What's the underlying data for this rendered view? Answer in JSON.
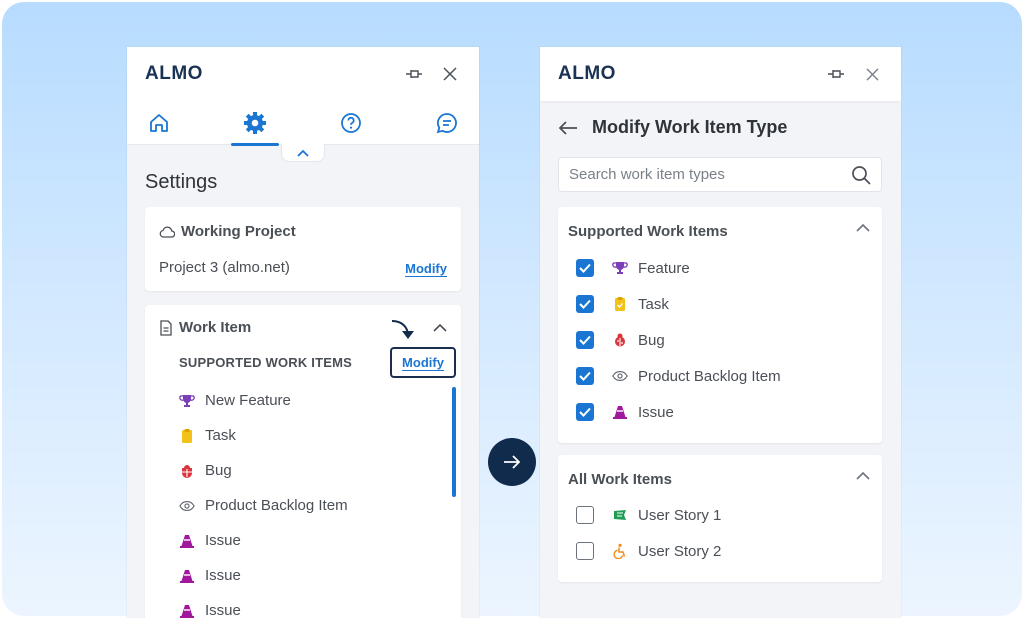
{
  "app": {
    "logo_text": "ALMO"
  },
  "left_panel": {
    "settings_title": "Settings",
    "nav_tabs": [
      "home",
      "settings",
      "help",
      "chat"
    ],
    "working_project": {
      "title": "Working Project",
      "project_name": "Project 3 (almo.net)",
      "modify_label": "Modify"
    },
    "work_item": {
      "title": "Work Item",
      "section_label": "SUPPORTED WORK ITEMS",
      "modify_label": "Modify",
      "items": [
        {
          "label": "New Feature",
          "icon": "trophy-icon",
          "color": "#7b3fb8"
        },
        {
          "label": "Task",
          "icon": "clipboard-icon",
          "color": "#f2c21b"
        },
        {
          "label": "Bug",
          "icon": "bug-icon",
          "color": "#d9363e"
        },
        {
          "label": "Product Backlog Item",
          "icon": "eye-icon",
          "color": "#5f656d"
        },
        {
          "label": "Issue",
          "icon": "cone-icon",
          "color": "#a0199c"
        },
        {
          "label": "Issue",
          "icon": "cone-icon",
          "color": "#a0199c"
        },
        {
          "label": "Issue",
          "icon": "cone-icon",
          "color": "#a0199c"
        }
      ]
    }
  },
  "right_panel": {
    "title": "Modify Work Item Type",
    "search_placeholder": "Search work item types",
    "supported": {
      "title": "Supported Work Items",
      "items": [
        {
          "label": "Feature",
          "checked": true,
          "icon": "trophy-icon",
          "color": "#7b3fb8"
        },
        {
          "label": "Task",
          "checked": true,
          "icon": "clipboard-icon",
          "color": "#f2c21b"
        },
        {
          "label": "Bug",
          "checked": true,
          "icon": "bug-icon",
          "color": "#d9363e"
        },
        {
          "label": "Product Backlog Item",
          "checked": true,
          "icon": "eye-icon",
          "color": "#5f656d"
        },
        {
          "label": "Issue",
          "checked": true,
          "icon": "cone-icon",
          "color": "#a0199c"
        }
      ]
    },
    "all": {
      "title": "All Work Items",
      "items": [
        {
          "label": "User Story 1",
          "checked": false,
          "icon": "flag-icon",
          "color": "#1f9d55"
        },
        {
          "label": "User Story 2",
          "checked": false,
          "icon": "accessibility-icon",
          "color": "#f08c1a"
        }
      ]
    }
  },
  "colors": {
    "accent": "#1a76d2",
    "navy": "#102b4c"
  }
}
